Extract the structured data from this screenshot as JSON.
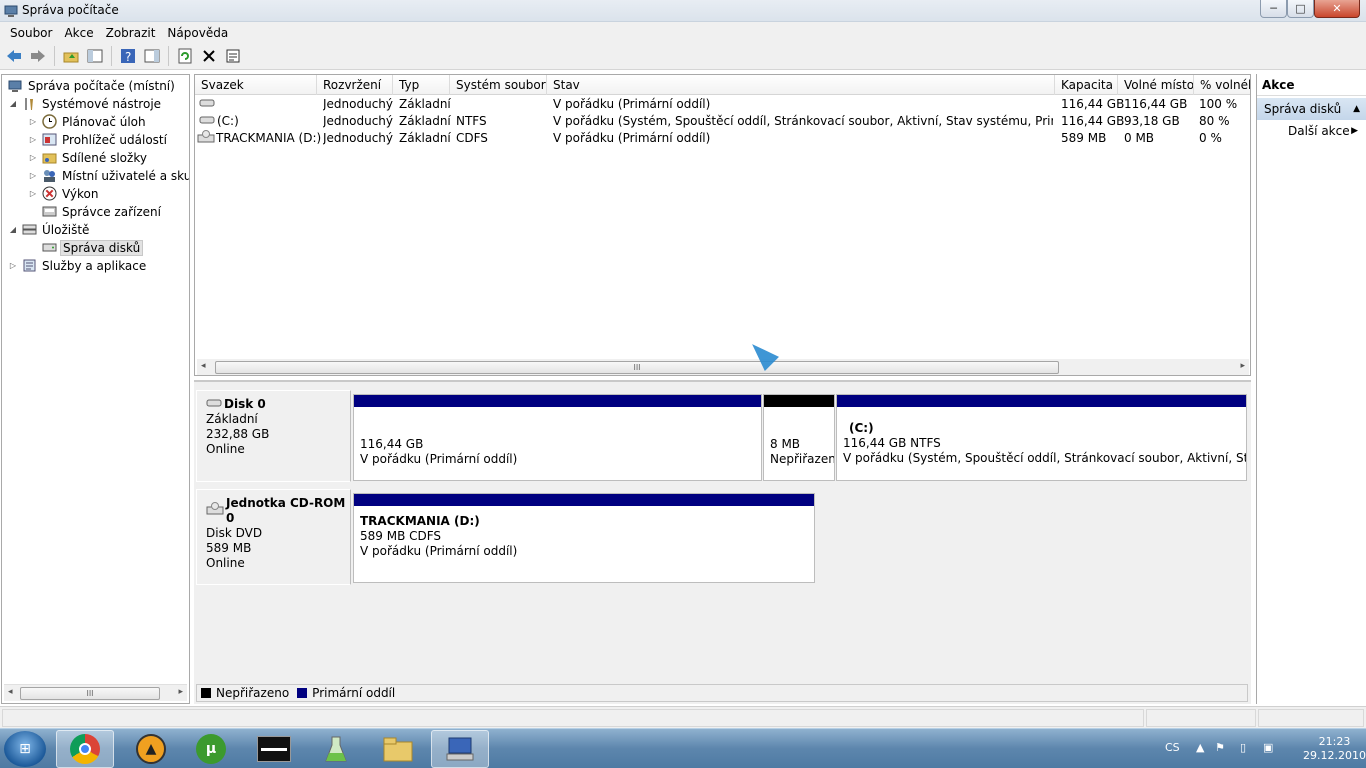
{
  "window": {
    "title": "Správa počítače",
    "btn_min": "─",
    "btn_max": "□",
    "btn_close": "✕"
  },
  "menu": [
    "Soubor",
    "Akce",
    "Zobrazit",
    "Nápověda"
  ],
  "tree": {
    "root": "Správa počítače (místní)",
    "system_tools": "Systémové nástroje",
    "task_scheduler": "Plánovač úloh",
    "event_viewer": "Prohlížeč událostí",
    "shared_folders": "Sdílené složky",
    "local_users": "Místní uživatelé a skupiny",
    "performance": "Výkon",
    "device_manager": "Správce zařízení",
    "storage": "Úložiště",
    "disk_management": "Správa disků",
    "services_apps": "Služby a aplikace"
  },
  "volumes": {
    "columns": [
      "Svazek",
      "Rozvržení",
      "Typ",
      "Systém souborů",
      "Stav",
      "Kapacita",
      "Volné místo",
      "% volného"
    ],
    "rows": [
      [
        "",
        "Jednoduchý",
        "Základní",
        "",
        "V pořádku (Primární oddíl)",
        "116,44 GB",
        "116,44 GB",
        "100 %"
      ],
      [
        "(C:)",
        "Jednoduchý",
        "Základní",
        "NTFS",
        "V pořádku (Systém, Spouštěcí oddíl, Stránkovací soubor, Aktivní, Stav systému, Primární oddíl)",
        "116,44 GB",
        "93,18 GB",
        "80 %"
      ],
      [
        "TRACKMANIA (D:)",
        "Jednoduchý",
        "Základní",
        "CDFS",
        "V pořádku (Primární oddíl)",
        "589 MB",
        "0 MB",
        "0 %"
      ]
    ],
    "scroll_grip": "III"
  },
  "disks": {
    "disk0": {
      "name": "Disk 0",
      "type": "Základní",
      "size": "232,88 GB",
      "status": "Online",
      "partitions": [
        {
          "title": "",
          "size": "116,44 GB",
          "status": "V pořádku (Primární oddíl)"
        },
        {
          "title": "",
          "size": "8 MB",
          "status": "Nepřiřazeno"
        },
        {
          "title": "(C:)",
          "size": "116,44 GB NTFS",
          "status": "V pořádku (Systém, Spouštěcí oddíl, Stránkovací soubor, Aktivní, Stav systému, Primární oddíl)"
        }
      ]
    },
    "cdrom0": {
      "name": "Jednotka CD-ROM 0",
      "type": "Disk DVD",
      "size": "589 MB",
      "status": "Online",
      "partition": {
        "title": "TRACKMANIA  (D:)",
        "size": "589 MB CDFS",
        "status": "V pořádku (Primární oddíl)"
      }
    }
  },
  "legend": {
    "unallocated": "Nepřiřazeno",
    "primary": "Primární oddíl"
  },
  "actions": {
    "header": "Akce",
    "selected": "Správa disků",
    "more": "Další akce"
  },
  "tray": {
    "lang": "CS",
    "time": "21:23",
    "date": "29.12.2010"
  },
  "colors": {
    "primary_partition": "#000080",
    "unallocated": "#000000",
    "taskbar": "#5d86ad"
  }
}
